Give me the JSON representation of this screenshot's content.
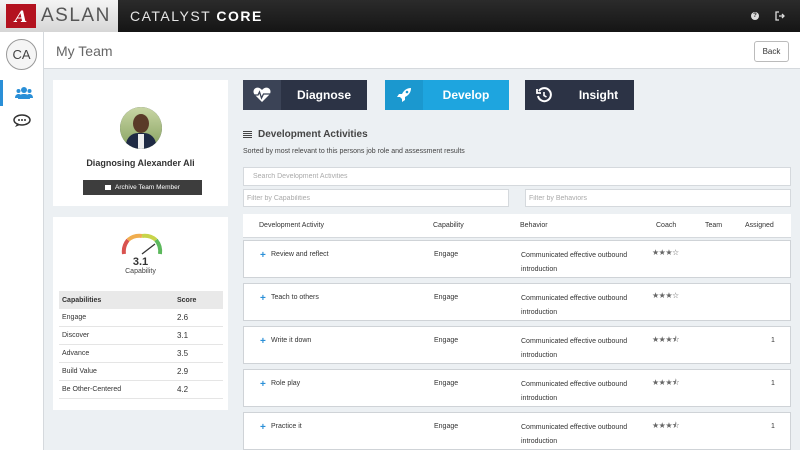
{
  "topbar": {
    "brand_mark": "A",
    "brand_name": "ASLAN",
    "product_prefix": "CATALYST ",
    "product_suffix": "CORE",
    "help_icon": "?",
    "logout_icon": "sign-out-icon"
  },
  "leftnav": {
    "avatar_initials": "CA",
    "items": [
      {
        "name": "team",
        "icon": "users-icon"
      },
      {
        "name": "chat",
        "icon": "comments-icon"
      }
    ]
  },
  "header": {
    "title": "My Team",
    "back_label": "Back"
  },
  "profile": {
    "name": "Diagnosing Alexander Ali",
    "archive_label": "Archive Team Member"
  },
  "score": {
    "value": "3.1",
    "label": "Capability",
    "table_headers": [
      "Capabilities",
      "Score"
    ],
    "rows": [
      {
        "name": "Engage",
        "score": "2.6"
      },
      {
        "name": "Discover",
        "score": "3.1"
      },
      {
        "name": "Advance",
        "score": "3.5"
      },
      {
        "name": "Build Value",
        "score": "2.9"
      },
      {
        "name": "Be Other-Centered",
        "score": "4.2"
      }
    ]
  },
  "actions": {
    "diagnose": "Diagnose",
    "develop": "Develop",
    "insight": "Insight"
  },
  "activities": {
    "title": "Development Activities",
    "subtitle": "Sorted by most relevant to this persons job role and assessment results",
    "search_placeholder": "Search Development Activities",
    "filter_capabilities_placeholder": "Filter by Capabilities",
    "filter_behaviors_placeholder": "Filter by Behaviors",
    "headers": {
      "activity": "Development Activity",
      "capability": "Capability",
      "behavior": "Behavior",
      "coach": "Coach",
      "team": "Team",
      "assigned": "Assigned"
    },
    "rows": [
      {
        "activity": "Review and reflect",
        "capability": "Engage",
        "behavior": "Communicated effective outbound introduction",
        "coach": "★★★☆",
        "assigned": ""
      },
      {
        "activity": "Teach to others",
        "capability": "Engage",
        "behavior": "Communicated effective outbound introduction",
        "coach": "★★★☆",
        "assigned": ""
      },
      {
        "activity": "Write it down",
        "capability": "Engage",
        "behavior": "Communicated effective outbound introduction",
        "coach": "★★★⯪",
        "assigned": "1"
      },
      {
        "activity": "Role play",
        "capability": "Engage",
        "behavior": "Communicated effective outbound introduction",
        "coach": "★★★⯪",
        "assigned": "1"
      },
      {
        "activity": "Practice it",
        "capability": "Engage",
        "behavior": "Communicated effective outbound introduction",
        "coach": "★★★⯪",
        "assigned": "1"
      }
    ]
  },
  "colors": {
    "accent": "#1ea5df",
    "dark_button": "#2c3345",
    "brand_red": "#b3121f"
  }
}
